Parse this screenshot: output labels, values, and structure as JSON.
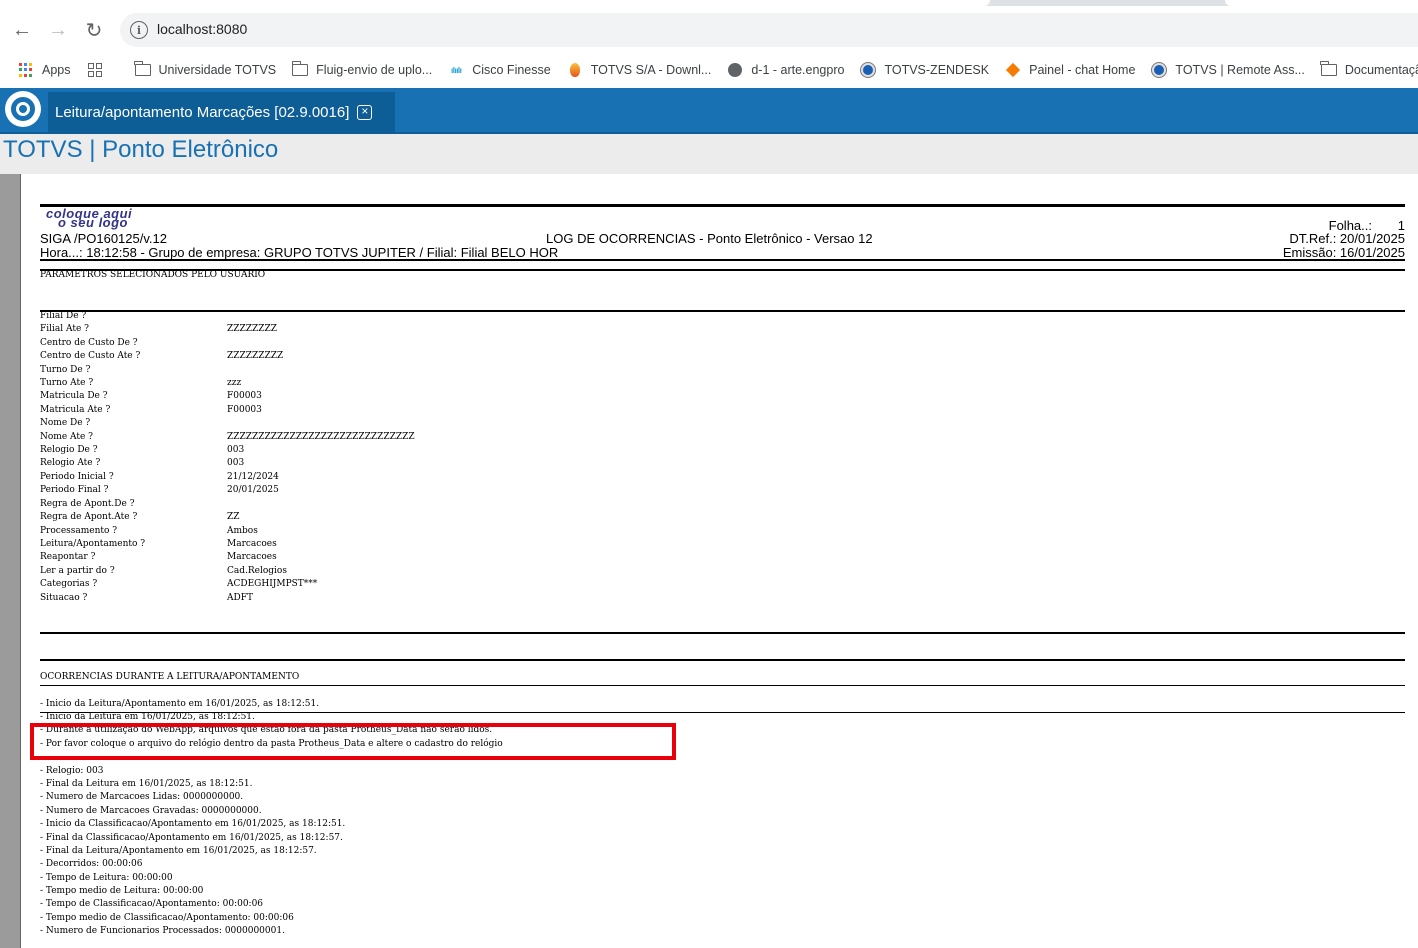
{
  "browser": {
    "url": "localhost:8080",
    "bookmarks": [
      {
        "label": "Apps",
        "icon": "apps-grid-icon"
      },
      {
        "label": "",
        "icon": "grid-icon"
      },
      {
        "label": "Universidade TOTVS",
        "icon": "folder-icon"
      },
      {
        "label": "Fluig-envio de uplo...",
        "icon": "folder-icon"
      },
      {
        "label": "Cisco Finesse",
        "icon": "cisco-icon"
      },
      {
        "label": "TOTVS S/A - Downl...",
        "icon": "flame-icon"
      },
      {
        "label": "d-1 - arte.engpro",
        "icon": "globe-icon"
      },
      {
        "label": "TOTVS-ZENDESK",
        "icon": "totvs-icon"
      },
      {
        "label": "Painel - chat Home",
        "icon": "diamond-icon"
      },
      {
        "label": "TOTVS | Remote Ass...",
        "icon": "totvs-icon"
      },
      {
        "label": "Documentação Po...",
        "icon": "folder-icon"
      }
    ]
  },
  "app": {
    "tab_label": "Leitura/apontamento Marcações [02.9.0016]",
    "title": "TOTVS | Ponto Eletrônico",
    "brand_color": "#1771b3"
  },
  "report": {
    "logo_line1": "coloque aqui",
    "logo_line2": "o seu logo",
    "program": "SIGA /PO160125/v.12",
    "report_title": "LOG DE OCORRENCIAS - Ponto Eletrônico - Versao 12",
    "hora_line": "Hora...: 18:12:58 - Grupo de empresa: GRUPO TOTVS JUPITER / Filial: Filial BELO HOR",
    "folha_label": "Folha..:",
    "folha_value": "1",
    "dtref": "DT.Ref.: 20/01/2025",
    "emissao": "Emissão: 16/01/2025",
    "params_section": "PARAMETROS SELECIONADOS PELO USUARIO",
    "params": [
      {
        "label": "Filial De ?",
        "value": ""
      },
      {
        "label": "Filial Ate ?",
        "value": "ZZZZZZZZ"
      },
      {
        "label": "Centro de Custo De ?",
        "value": ""
      },
      {
        "label": "Centro de Custo Ate ?",
        "value": "ZZZZZZZZZ"
      },
      {
        "label": "Turno De ?",
        "value": ""
      },
      {
        "label": "Turno Ate ?",
        "value": "zzz"
      },
      {
        "label": "Matricula De ?",
        "value": "F00003"
      },
      {
        "label": "Matricula Ate ?",
        "value": "F00003"
      },
      {
        "label": "Nome De ?",
        "value": ""
      },
      {
        "label": "Nome Ate ?",
        "value": "ZZZZZZZZZZZZZZZZZZZZZZZZZZZZZZ"
      },
      {
        "label": "Relogio De ?",
        "value": "003"
      },
      {
        "label": "Relogio Ate ?",
        "value": "003"
      },
      {
        "label": "Periodo Inicial ?",
        "value": "21/12/2024"
      },
      {
        "label": "Periodo Final ?",
        "value": "20/01/2025"
      },
      {
        "label": "Regra de Apont.De ?",
        "value": ""
      },
      {
        "label": "Regra de Apont.Ate ?",
        "value": "ZZ"
      },
      {
        "label": "Processamento ?",
        "value": "Ambos"
      },
      {
        "label": "Leitura/Apontamento ?",
        "value": "Marcacoes"
      },
      {
        "label": "Reapontar ?",
        "value": "Marcacoes"
      },
      {
        "label": "Ler a partir do ?",
        "value": "Cad.Relogios"
      },
      {
        "label": "Categorias ?",
        "value": "ACDEGHIJMPST***"
      },
      {
        "label": "Situacao ?",
        "value": "ADFT"
      }
    ],
    "occ_section": "OCORRENCIAS DURANTE A LEITURA/APONTAMENTO",
    "occ_first": "- Inicio da Leitura/Apontamento em 16/01/2025, as 18:12:51.",
    "occurrences": [
      "- Inicio da Leitura em 16/01/2025, as 18:12:51.",
      "- Durante a utilização do WebApp, arquivos que estão fora da pasta Protheus_Data não serão lidos.",
      "- Por favor coloque o arquivo do relógio dentro da pasta Protheus_Data e altere o cadastro do relógio",
      "",
      "- Relogio: 003",
      "- Final da Leitura em 16/01/2025, as 18:12:51.",
      "- Numero de Marcacoes Lidas: 0000000000.",
      "- Numero de Marcacoes Gravadas: 0000000000.",
      "- Inicio da Classificacao/Apontamento em 16/01/2025, as 18:12:51.",
      "- Final da Classificacao/Apontamento em 16/01/2025, as 18:12:57.",
      "- Final da Leitura/Apontamento em 16/01/2025, as 18:12:57.",
      "- Decorridos: 00:00:06",
      "- Tempo de Leitura: 00:00:00",
      "- Tempo medio de Leitura: 00:00:00",
      "- Tempo de Classificacao/Apontamento: 00:00:06",
      "- Tempo medio de Classificacao/Apontamento: 00:00:06",
      "- Numero de Funcionarios Processados: 0000000001."
    ]
  }
}
